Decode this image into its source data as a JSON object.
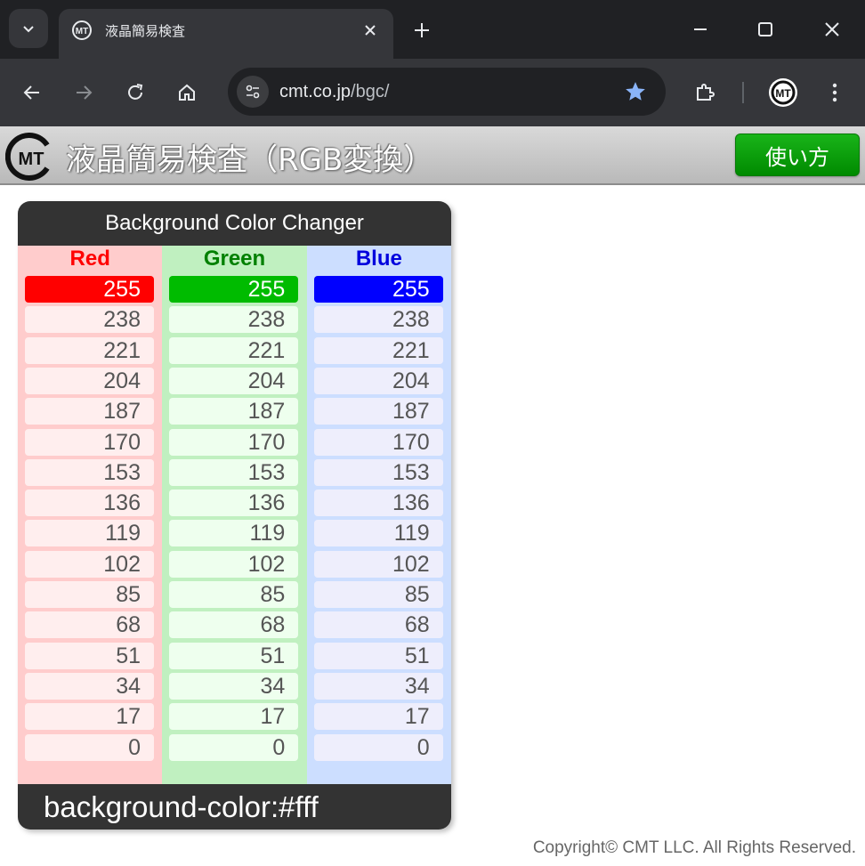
{
  "browser": {
    "tab_title": "液晶簡易検査",
    "url_domain": "cmt.co.jp",
    "url_path": "/bgc/",
    "colors": {
      "frame": "#202124",
      "toolbar": "#35363a",
      "star": "#8ab4f8"
    }
  },
  "page": {
    "title": "液晶簡易検査（RGB変換）",
    "help_button": "使い方",
    "logo_text": "MT",
    "copyright": "Copyright© CMT LLC. All Rights Reserved."
  },
  "widget": {
    "title": "Background Color Changer",
    "footer": "background-color:#fff",
    "columns": [
      {
        "name": "Red",
        "header_color": "#ff0000",
        "bg": "#ffcccc",
        "cell_bg": "#ffeeee",
        "selected_bg": "#ff0000",
        "selected": "255",
        "values": [
          "255",
          "238",
          "221",
          "204",
          "187",
          "170",
          "153",
          "136",
          "119",
          "102",
          "85",
          "68",
          "51",
          "34",
          "17",
          "0"
        ]
      },
      {
        "name": "Green",
        "header_color": "#008000",
        "bg": "#c0f0c0",
        "cell_bg": "#eeffee",
        "selected_bg": "#00bb00",
        "selected": "255",
        "values": [
          "255",
          "238",
          "221",
          "204",
          "187",
          "170",
          "153",
          "136",
          "119",
          "102",
          "85",
          "68",
          "51",
          "34",
          "17",
          "0"
        ]
      },
      {
        "name": "Blue",
        "header_color": "#0000dd",
        "bg": "#ccdeff",
        "cell_bg": "#eeeefc",
        "selected_bg": "#0000ff",
        "selected": "255",
        "values": [
          "255",
          "238",
          "221",
          "204",
          "187",
          "170",
          "153",
          "136",
          "119",
          "102",
          "85",
          "68",
          "51",
          "34",
          "17",
          "0"
        ]
      }
    ]
  }
}
